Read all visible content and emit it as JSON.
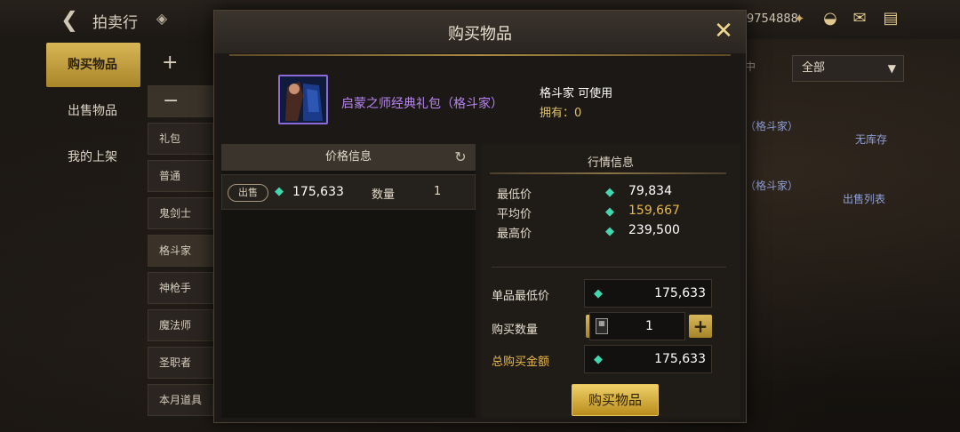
{
  "topbar": {
    "title": "拍卖行",
    "currency_text": "9754888",
    "icons": [
      "back-icon",
      "diamond-icon",
      "currency-icon",
      "pot-icon",
      "mail-icon",
      "chat-icon"
    ]
  },
  "side_tabs": [
    {
      "label": "购买物品",
      "active": true
    },
    {
      "label": "出售物品",
      "active": false
    },
    {
      "label": "我的上架",
      "active": false
    }
  ],
  "categories": {
    "plus": "+",
    "minus": "−",
    "items": [
      "礼包",
      "普通",
      "鬼剑士",
      "格斗家",
      "神枪手",
      "魔法师",
      "圣职者",
      "本月道具"
    ]
  },
  "background_right": {
    "dim_text": "中",
    "dropdown": "全部",
    "row1_name": "（格斗家）",
    "row1_status": "无库存",
    "row2_name": "（格斗家）",
    "row2_status": "出售列表"
  },
  "modal": {
    "title": "购买物品",
    "item": {
      "name": "启蒙之师经典礼包（格斗家）",
      "usable": "格斗家 可使用",
      "owned": "拥有：0"
    },
    "price_info": {
      "header": "价格信息",
      "row": {
        "badge": "出售",
        "price": "175,633",
        "qty_label": "数量",
        "qty": "1"
      }
    },
    "market_info": {
      "header": "行情信息",
      "min_label": "最低价",
      "min_value": "79,834",
      "avg_label": "平均价",
      "avg_value": "159,667",
      "max_label": "最高价",
      "max_value": "239,500"
    },
    "purchase": {
      "unit_label": "单品最低价",
      "unit_value": "175,633",
      "qty_label": "购买数量",
      "qty_value": "1",
      "total_label": "总购买金额",
      "total_value": "175,633",
      "buy_button": "购买物品"
    }
  },
  "colors": {
    "gold": "#d8b655",
    "price_gold": "#e8b84a",
    "item_purple": "#b784f2",
    "gem_green": "#41d7b0"
  }
}
